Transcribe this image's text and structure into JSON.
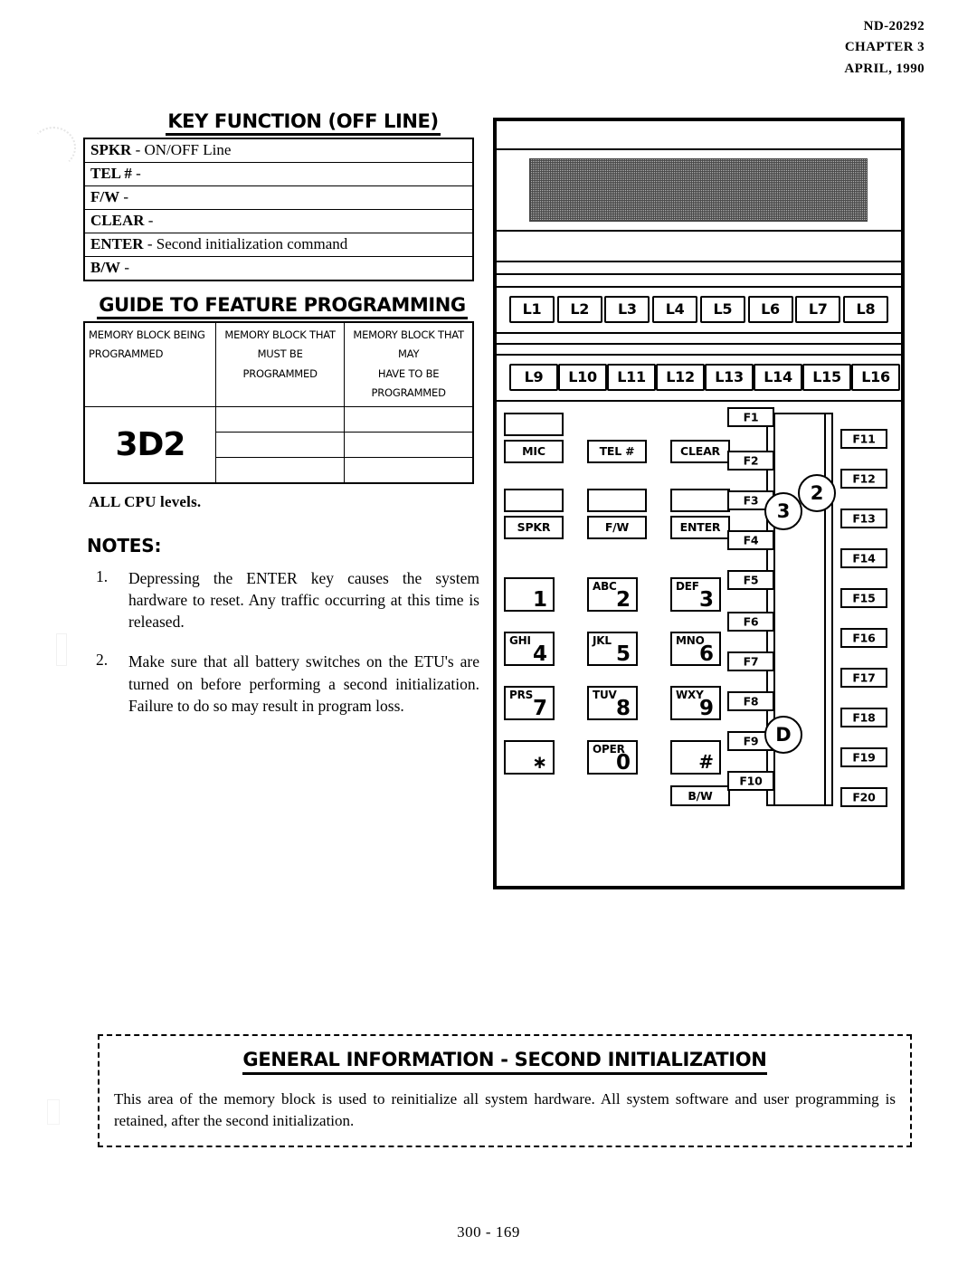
{
  "header": {
    "doc_number": "ND-20292",
    "chapter": "CHAPTER 3",
    "date": "APRIL, 1990"
  },
  "key_function": {
    "title": "KEY FUNCTION (OFF LINE)",
    "rows": [
      {
        "key": "SPKR",
        "desc": "- ON/OFF Line"
      },
      {
        "key": "TEL #",
        "desc": "-"
      },
      {
        "key": "F/W",
        "desc": "-"
      },
      {
        "key": "CLEAR",
        "desc": "-"
      },
      {
        "key": "ENTER",
        "desc": "- Second initialization  command"
      },
      {
        "key": "B/W",
        "desc": "-"
      }
    ]
  },
  "guide": {
    "title": "GUIDE TO FEATURE PROGRAMMING",
    "headers": [
      "MEMORY BLOCK BEING\nPROGRAMMED",
      "MEMORY BLOCK THAT\nMUST BE PROGRAMMED",
      "MEMORY BLOCK THAT MAY\nHAVE TO BE PROGRAMMED"
    ],
    "header_lines": {
      "c1_line1": "MEMORY BLOCK BEING",
      "c1_line2": "PROGRAMMED",
      "c2_line1": "MEMORY BLOCK THAT",
      "c2_line2": "MUST BE PROGRAMMED",
      "c3_line1": "MEMORY BLOCK THAT MAY",
      "c3_line2": "HAVE TO BE PROGRAMMED"
    },
    "block_id": "3D2",
    "row_count": 3,
    "cpu_note": "ALL CPU levels."
  },
  "notes": {
    "title": "NOTES:",
    "items": [
      {
        "num": "1.",
        "text": "Depressing the ENTER key causes the system hardware to reset.  Any traffic occurring at this time is released."
      },
      {
        "num": "2.",
        "text": "Make sure that all battery switches on the ETU's are turned on before performing a second initialization.  Failure to do so may result in program loss."
      }
    ]
  },
  "phone": {
    "line_keys_row1": [
      "L1",
      "L2",
      "L3",
      "L4",
      "L5",
      "L6",
      "L7",
      "L8"
    ],
    "line_keys_row2": [
      "L9",
      "L10",
      "L11",
      "L12",
      "L13",
      "L14",
      "L15",
      "L16"
    ],
    "function_keys": [
      "MIC",
      "TEL #",
      "CLEAR",
      "SPKR",
      "F/W",
      "ENTER"
    ],
    "bw_key": "B/W",
    "dial_keys": [
      {
        "letters": "",
        "digit": "1"
      },
      {
        "letters": "ABC",
        "digit": "2"
      },
      {
        "letters": "DEF",
        "digit": "3"
      },
      {
        "letters": "GHI",
        "digit": "4"
      },
      {
        "letters": "JKL",
        "digit": "5"
      },
      {
        "letters": "MNO",
        "digit": "6"
      },
      {
        "letters": "PRS",
        "digit": "7"
      },
      {
        "letters": "TUV",
        "digit": "8"
      },
      {
        "letters": "WXY",
        "digit": "9"
      },
      {
        "letters": "",
        "digit": "∗"
      },
      {
        "letters": "OPER",
        "digit": "0"
      },
      {
        "letters": "",
        "digit": "#"
      }
    ],
    "f_keys_left": [
      "F1",
      "F2",
      "F3",
      "F4",
      "F5",
      "F6",
      "F7",
      "F8",
      "F9",
      "F10"
    ],
    "f_keys_right": [
      "F11",
      "F12",
      "F13",
      "F14",
      "F15",
      "F16",
      "F17",
      "F18",
      "F19",
      "F20"
    ],
    "markers": [
      "3",
      "2",
      "D"
    ]
  },
  "general_info": {
    "title": "GENERAL INFORMATION  -  SECOND INITIALIZATION",
    "body": "This area of the memory block is used to reinitialize all system hardware.  All system software and user programming is retained, after the second initialization."
  },
  "footer": {
    "page_number": "300 - 169"
  }
}
